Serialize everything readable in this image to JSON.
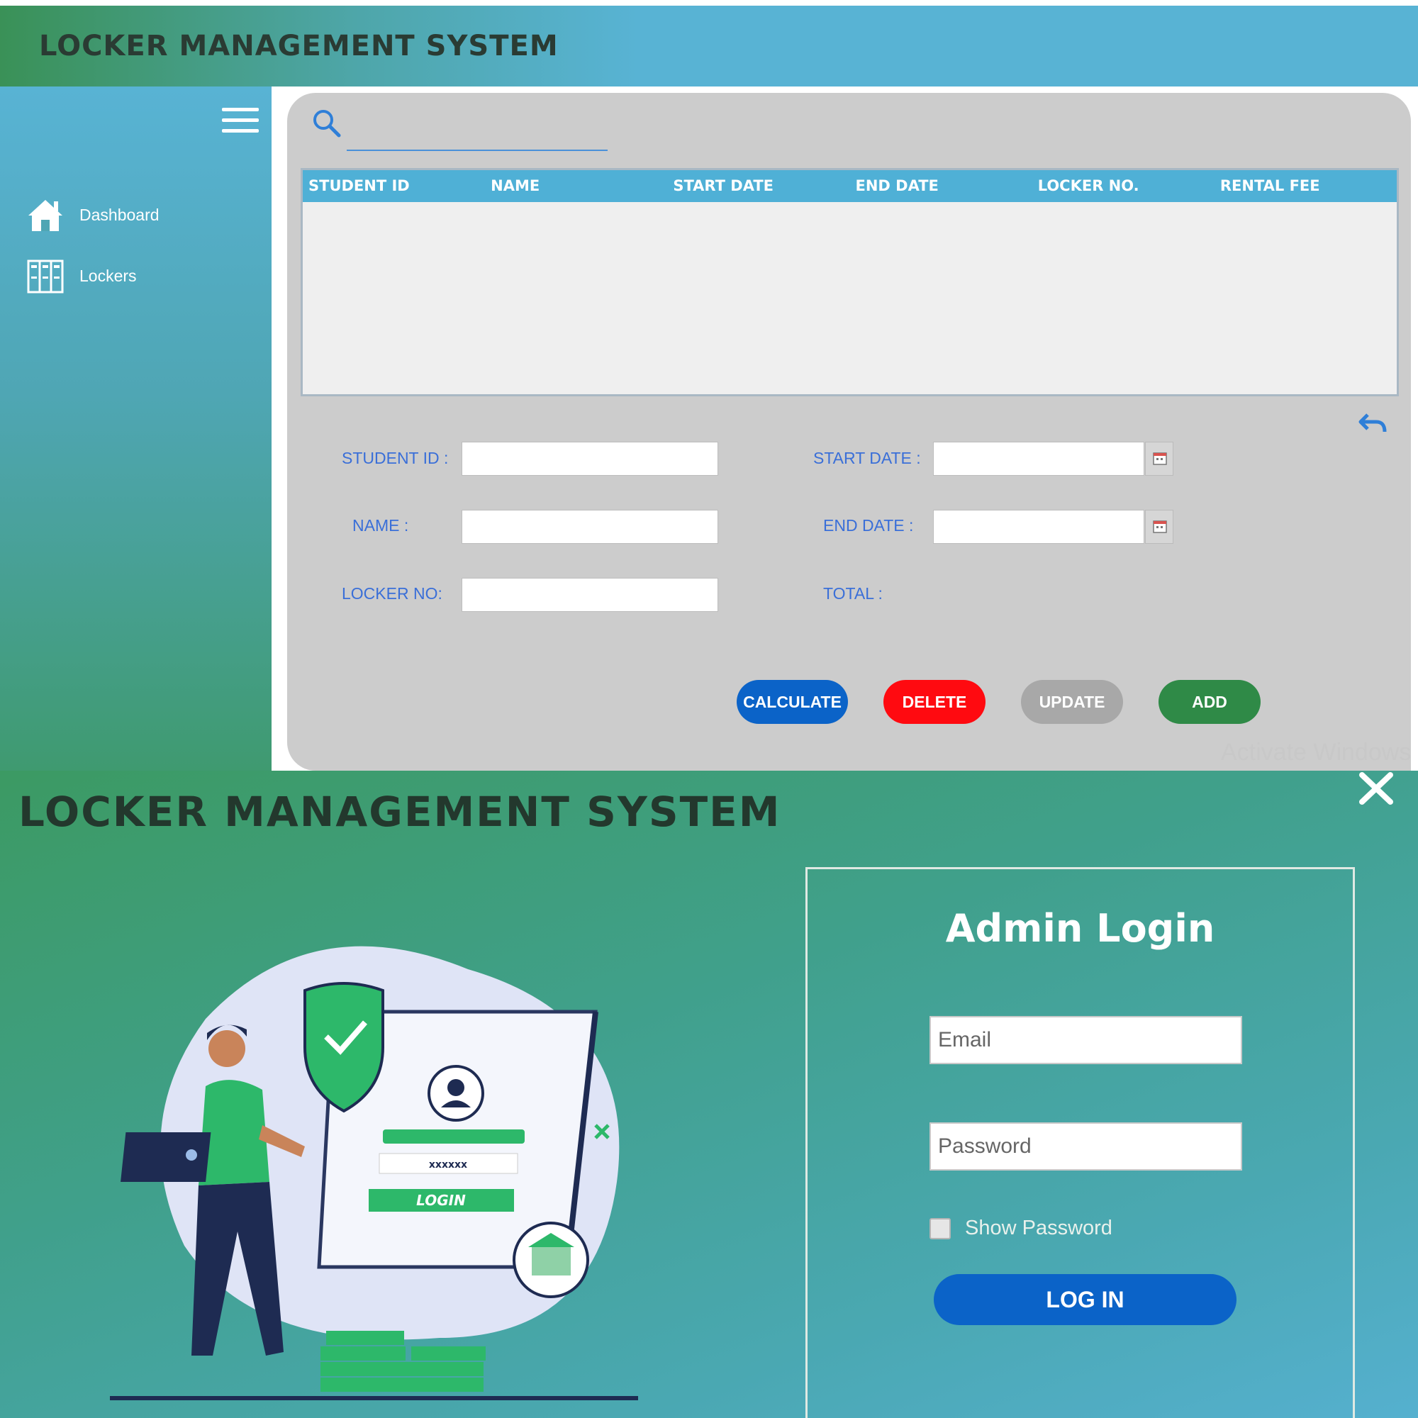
{
  "dashboard": {
    "app_title": "LOCKER MANAGEMENT SYSTEM",
    "sidebar": {
      "items": [
        {
          "label": "Dashboard",
          "icon": "home-icon"
        },
        {
          "label": "Lockers",
          "icon": "lockers-icon"
        }
      ]
    },
    "search": {
      "placeholder": ""
    },
    "table": {
      "columns": [
        "STUDENT ID",
        "NAME",
        "START DATE",
        "END DATE",
        "LOCKER NO.",
        "RENTAL FEE"
      ],
      "rows": []
    },
    "form": {
      "student_id_label": "STUDENT ID :",
      "name_label": "NAME :",
      "locker_no_label": "LOCKER NO:",
      "start_date_label": "START DATE :",
      "end_date_label": "END DATE :",
      "total_label": "TOTAL :",
      "student_id_value": "",
      "name_value": "",
      "locker_no_value": "",
      "start_date_value": "",
      "end_date_value": ""
    },
    "buttons": {
      "calculate": "CALCULATE",
      "delete": "DELETE",
      "update": "UPDATE",
      "add": "ADD"
    },
    "watermark": "Activate Windows",
    "colors": {
      "header_blue": "#58b3d4",
      "header_green": "#3a9157",
      "calculate": "#0b63c8",
      "delete": "#ff0a10",
      "update": "#a8a8a8",
      "add": "#2f8a47",
      "label_blue": "#3a6fd8"
    }
  },
  "login": {
    "app_title": "LOCKER MANAGEMENT SYSTEM",
    "heading": "Admin Login",
    "email_placeholder": "Email",
    "password_placeholder": "Password",
    "show_password_label": "Show Password",
    "show_password_checked": false,
    "login_button": "LOG IN",
    "illustration": {
      "login_card_button": "LOGIN",
      "password_mask": "xxxxxx"
    }
  }
}
